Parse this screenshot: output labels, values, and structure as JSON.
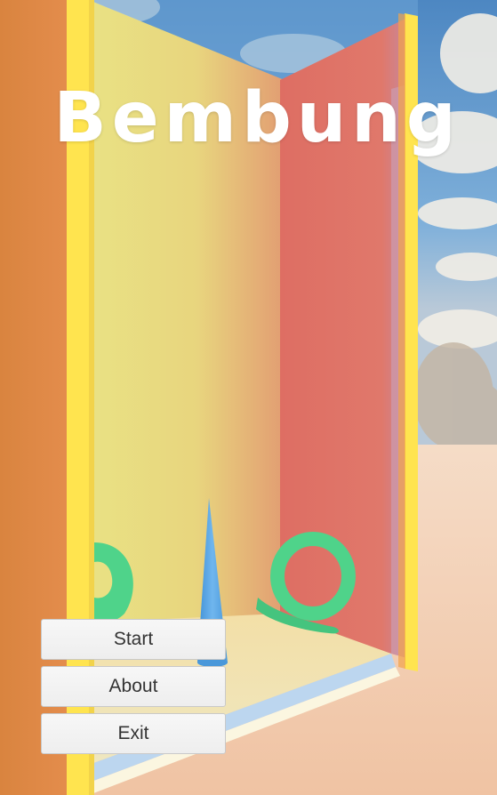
{
  "game": {
    "title": "Bembung"
  },
  "menu": {
    "start_label": "Start",
    "about_label": "About",
    "exit_label": "Exit"
  },
  "colors": {
    "title": "#ffffff",
    "button_bg": "#f2f2f2",
    "button_text": "#333333",
    "frame_yellow": "#ffe550",
    "left_wall": "#e08a4a",
    "back_wall_yellow": "#e9de7e",
    "right_wall_red": "#de6f66",
    "torus_green": "#4fd38a",
    "cone_blue": "#5aa9e6",
    "sky": "#5b93c9",
    "ground": "#f3d2b8"
  }
}
